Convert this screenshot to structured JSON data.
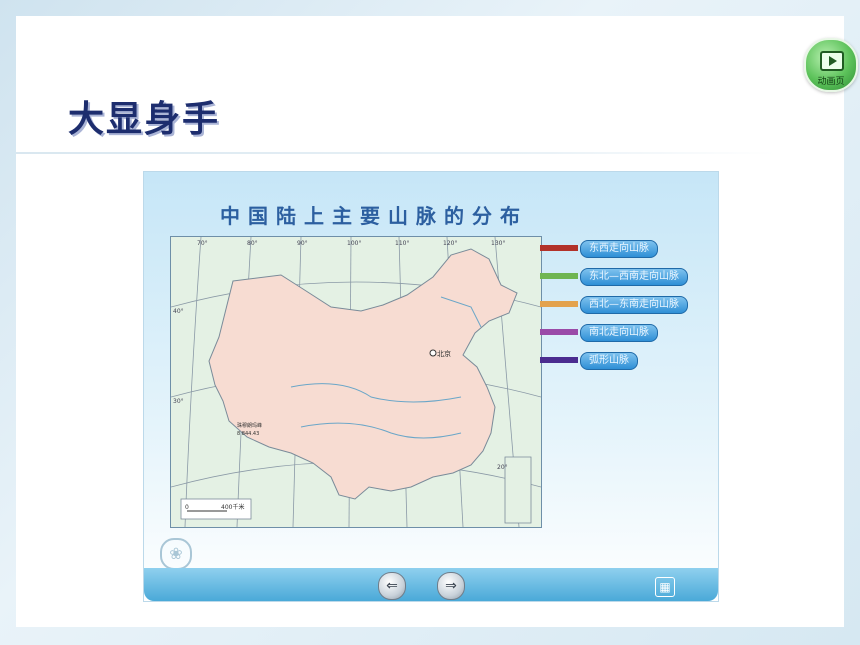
{
  "slide": {
    "title": "大显身手",
    "anim_button_label": "动画页"
  },
  "panel": {
    "title": "中国陆上主要山脉的分布",
    "legend": [
      {
        "label": "东西走向山脉",
        "color": "#b2322a"
      },
      {
        "label": "东北—西南走向山脉",
        "color": "#6fb552"
      },
      {
        "label": "西北—东南走向山脉",
        "color": "#e3a24d"
      },
      {
        "label": "南北走向山脉",
        "color": "#9a4aa8"
      },
      {
        "label": "弧形山脉",
        "color": "#4b2c8f"
      }
    ],
    "map": {
      "capital_label": "北京",
      "longitude_labels": [
        "70°",
        "80°",
        "90°",
        "100°",
        "110°",
        "120°",
        "130°"
      ],
      "latitude_labels": [
        "40°",
        "30°",
        "20°"
      ],
      "peak_label": "珠穆朗玛峰",
      "peak_height": "8 844.43",
      "scale_left": "0",
      "scale_right": "400千米"
    },
    "nav": {
      "prev_icon": "prev-arrow-icon",
      "next_icon": "next-arrow-icon",
      "menu_icon": "grid-menu-icon"
    }
  }
}
